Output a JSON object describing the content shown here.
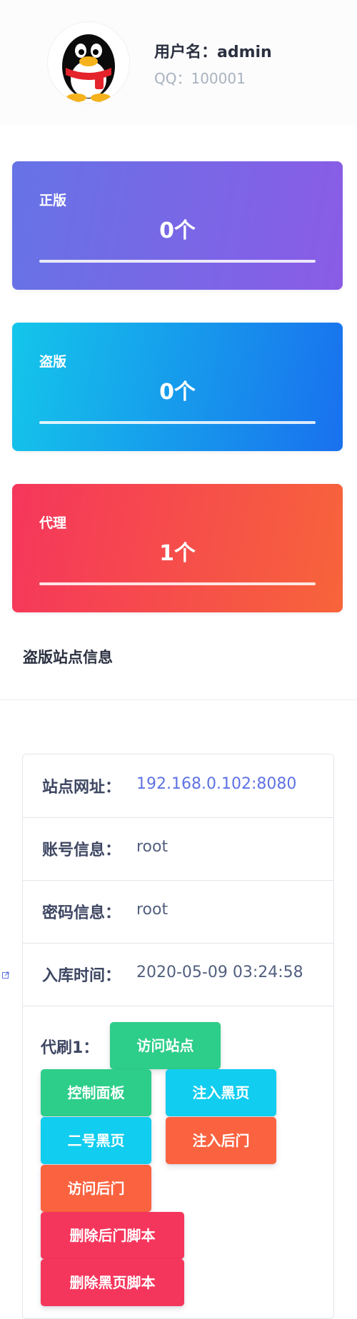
{
  "profile": {
    "username_label": "用户名：admin",
    "qq_label": "QQ：100001",
    "avatar_icon": "qq-penguin-icon"
  },
  "stats": {
    "genuine": {
      "label": "正版",
      "value": "0个"
    },
    "pirated": {
      "label": "盗版",
      "value": "0个"
    },
    "agent": {
      "label": "代理",
      "value": "1个"
    }
  },
  "section": {
    "title": "盗版站点信息"
  },
  "site": {
    "url_label": "站点网址：",
    "url_value": "192.168.0.102:8080",
    "account_label": "账号信息：",
    "account_value": "root",
    "password_label": "密码信息：",
    "password_value": "root",
    "time_label": "入库时间：",
    "time_value": "2020-05-09 03:24:58",
    "ops_label": "代刷1："
  },
  "actions": {
    "visit_site": "访问站点",
    "control_panel": "控制面板",
    "inject_blackpage": "注入黑页",
    "blackpage_two": "二号黑页",
    "inject_backdoor": "注入后门",
    "visit_backdoor": "访问后门",
    "delete_backdoor_script": "删除后门脚本",
    "delete_blackpage_script": "删除黑页脚本"
  },
  "colors": {
    "green": "#2dce89",
    "cyan": "#11cdef",
    "orange": "#fb6340",
    "red": "#f5365c",
    "link": "#5e72e4"
  }
}
